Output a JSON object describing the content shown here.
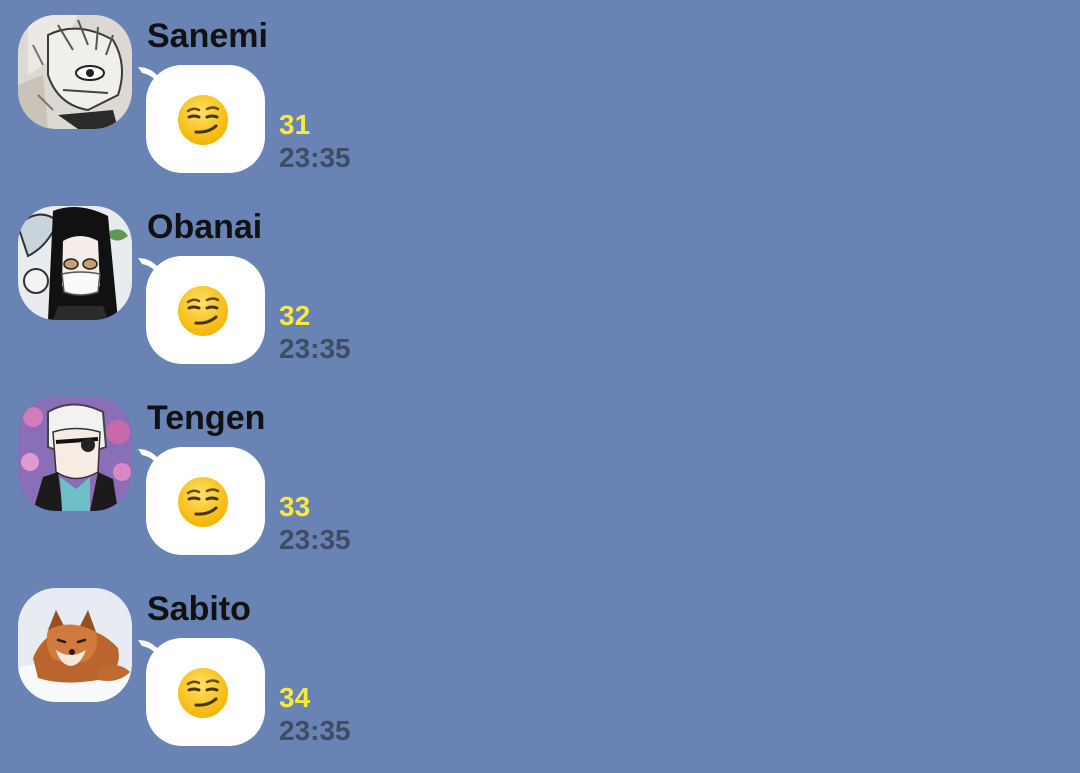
{
  "colors": {
    "background": "#6883b4",
    "bubble": "#ffffff",
    "read_count": "#f7e93f",
    "timestamp": "#3e4c66",
    "name": "#111111"
  },
  "messages": [
    {
      "sender": "Sanemi",
      "avatar": "avatar-sanemi",
      "emoji": "smirking-face",
      "read_count": "31",
      "time": "23:35"
    },
    {
      "sender": "Obanai",
      "avatar": "avatar-obanai",
      "emoji": "smirking-face",
      "read_count": "32",
      "time": "23:35"
    },
    {
      "sender": "Tengen",
      "avatar": "avatar-tengen",
      "emoji": "smirking-face",
      "read_count": "33",
      "time": "23:35"
    },
    {
      "sender": "Sabito",
      "avatar": "avatar-sabito-fox",
      "emoji": "smirking-face",
      "read_count": "34",
      "time": "23:35"
    }
  ]
}
